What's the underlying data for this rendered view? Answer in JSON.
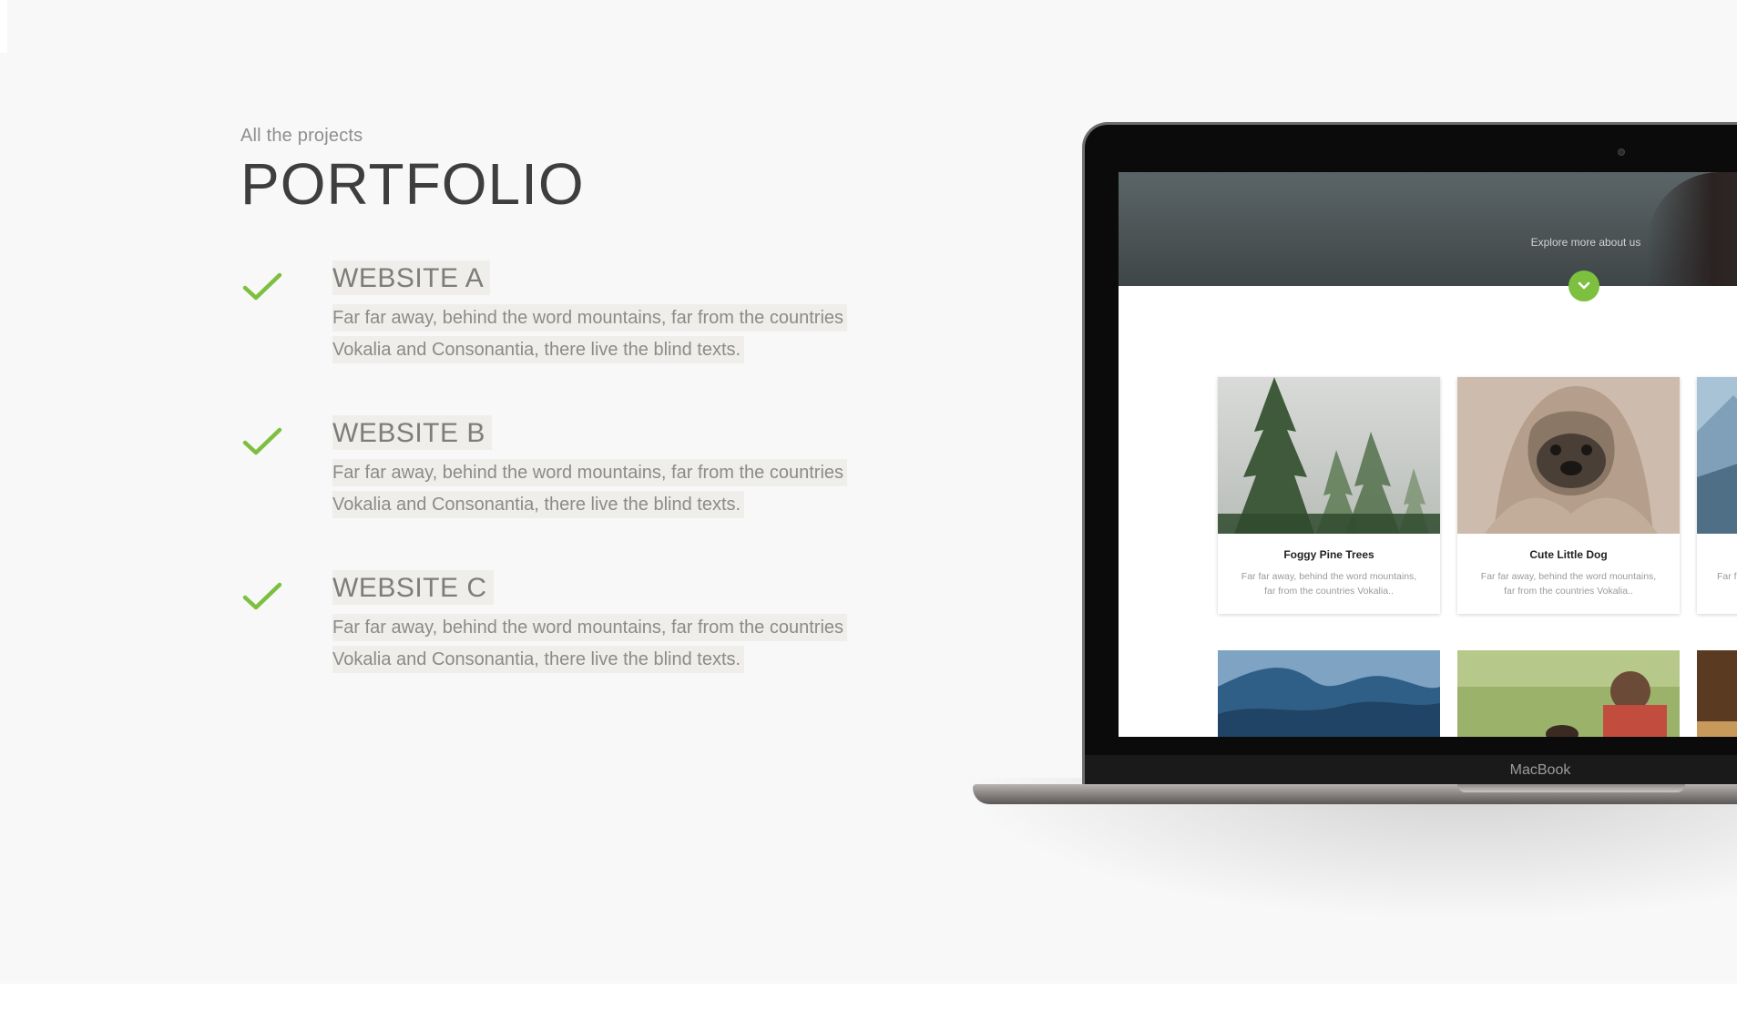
{
  "header": {
    "eyebrow": "All the projects",
    "title": "PORTFOLIO"
  },
  "features": [
    {
      "title": "WEBSITE A",
      "desc_line1": "Far far away, behind the word mountains, far from the countries",
      "desc_line2": "Vokalia and Consonantia, there live the blind texts."
    },
    {
      "title": "WEBSITE B",
      "desc_line1": "Far far away, behind the word mountains, far from the countries",
      "desc_line2": "Vokalia and Consonantia, there live the blind texts."
    },
    {
      "title": "WEBSITE C",
      "desc_line1": "Far far away, behind the word mountains, far from the countries",
      "desc_line2": "Vokalia and Consonantia, there live the blind texts."
    }
  ],
  "icons": {
    "feature": "checkmark-icon",
    "hero_button": "chevron-down-icon"
  },
  "colors": {
    "accent": "#7dbf3f",
    "title": "#3e3e3e",
    "text": "#8b8b8b",
    "background": "#f8f8f8"
  },
  "mockup": {
    "hero_text": "Explore more about us",
    "brand": "MacBook",
    "cards": [
      {
        "title": "Foggy Pine Trees",
        "desc_line1": "Far far away, behind the word mountains,",
        "desc_line2": "far from the countries Vokalia.."
      },
      {
        "title": "Cute Little Dog",
        "desc_line1": "Far far away, behind the word mountains,",
        "desc_line2": "far from the countries Vokalia.."
      },
      {
        "title": "",
        "desc_line1": "Far f"
      }
    ]
  }
}
